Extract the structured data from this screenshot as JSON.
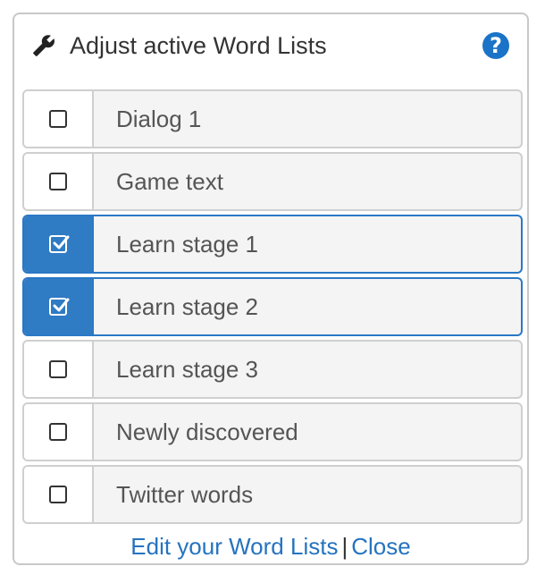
{
  "header": {
    "title": "Adjust active Word Lists",
    "icon": "wrench-icon",
    "help_icon": "question-circle-icon",
    "help_glyph": "?"
  },
  "lists": [
    {
      "label": "Dialog 1",
      "checked": false
    },
    {
      "label": "Game text",
      "checked": false
    },
    {
      "label": "Learn stage 1",
      "checked": true
    },
    {
      "label": "Learn stage 2",
      "checked": true
    },
    {
      "label": "Learn stage 3",
      "checked": false
    },
    {
      "label": "Newly discovered",
      "checked": false
    },
    {
      "label": "Twitter words",
      "checked": false
    }
  ],
  "footer": {
    "edit_link": "Edit your Word Lists",
    "separator": "|",
    "close_link": "Close"
  },
  "colors": {
    "accent": "#2f7bc4",
    "link": "#2573bf",
    "row_bg": "#f4f4f4",
    "border": "#cfcfcf"
  }
}
